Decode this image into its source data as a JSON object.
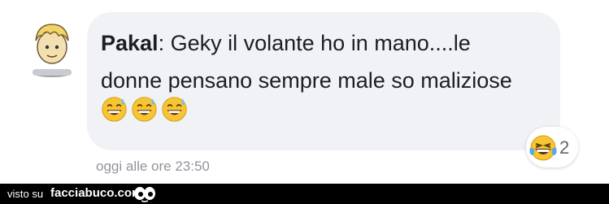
{
  "comment": {
    "author": "Pakal",
    "separator": ":",
    "text_line1": " Geky il volante ho in mano....le",
    "text_line2": "donne pensano sempre male so maliziose",
    "emojis": [
      "grinning-sweat-emoji",
      "grinning-sweat-emoji",
      "grinning-sweat-emoji"
    ],
    "timestamp": "oggi alle ore 23:50"
  },
  "reactions": {
    "icon": "laughing-tears-emoji",
    "count": "2"
  },
  "footer": {
    "visto_label": "visto su",
    "brand": "facciabuco.com"
  },
  "colors": {
    "bubble": "#f0f2f5",
    "text": "#1c1e21",
    "meta": "#90949c",
    "footer_bg": "#000000"
  }
}
